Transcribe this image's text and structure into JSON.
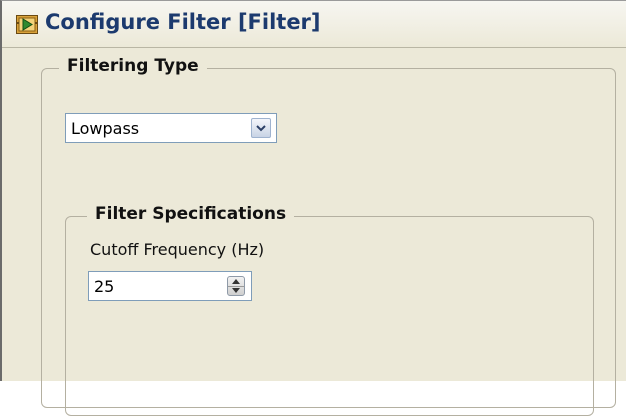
{
  "window": {
    "title": "Configure Filter [Filter]",
    "icon": "labview-express-vi-icon"
  },
  "filtering_type": {
    "legend": "Filtering Type",
    "selected": "Lowpass"
  },
  "filter_specifications": {
    "legend": "Filter Specifications",
    "cutoff_label": "Cutoff Frequency (Hz)",
    "cutoff_value": "25"
  },
  "colors": {
    "title_text": "#1c3a6e",
    "dialog_background": "#ece9d8"
  }
}
